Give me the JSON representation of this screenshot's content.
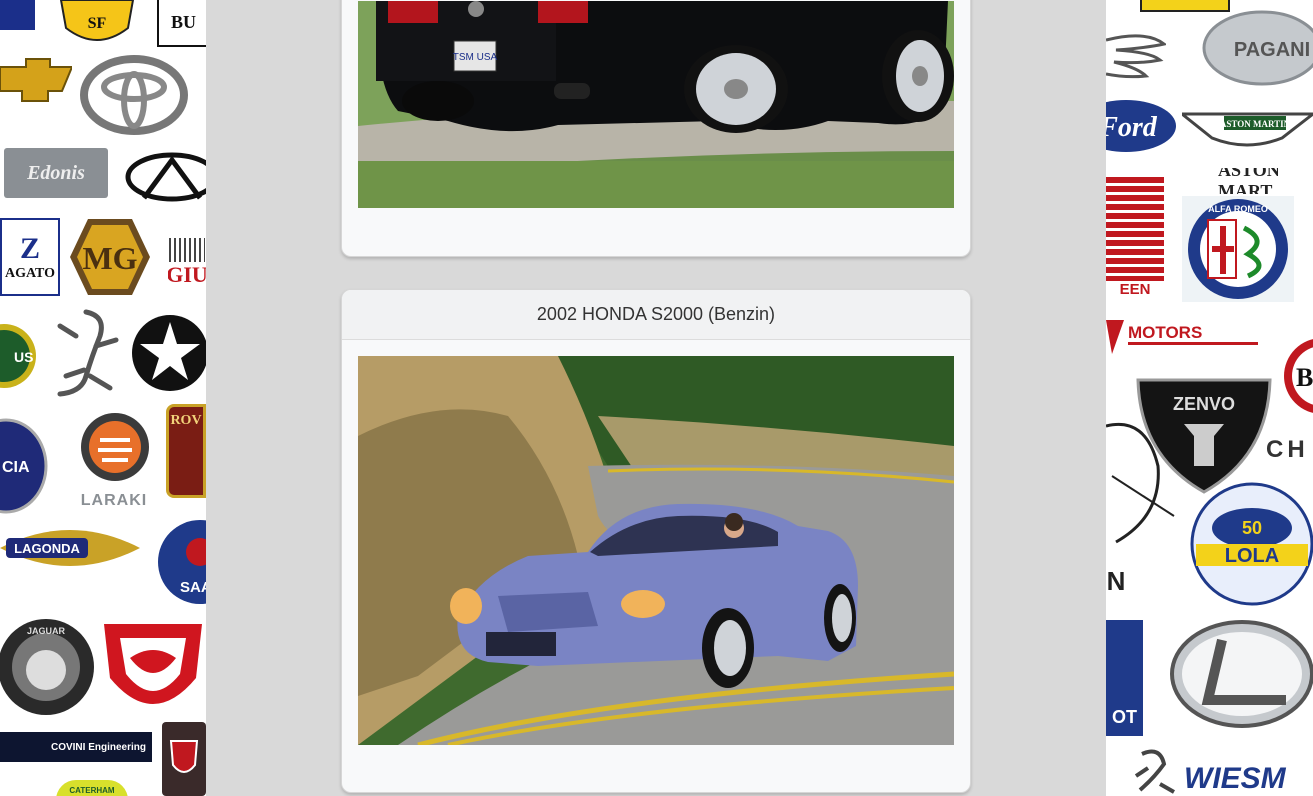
{
  "left_logos": [
    {
      "name": "logo-ferrari",
      "text": "SF"
    },
    {
      "name": "logo-bugatti",
      "text": "BU"
    },
    {
      "name": "logo-chevrolet",
      "text": ""
    },
    {
      "name": "logo-toyota",
      "text": ""
    },
    {
      "name": "logo-edonis",
      "text": "Edonis"
    },
    {
      "name": "logo-infiniti",
      "text": ""
    },
    {
      "name": "logo-zagato",
      "text": "AGATO"
    },
    {
      "name": "logo-mg",
      "text": "MG"
    },
    {
      "name": "logo-giugiaro",
      "text": "GIU"
    },
    {
      "name": "logo-lotus",
      "text": "US"
    },
    {
      "name": "logo-gecko",
      "text": ""
    },
    {
      "name": "logo-plymouth",
      "text": ""
    },
    {
      "name": "logo-rover",
      "text": "ROV"
    },
    {
      "name": "logo-lancia",
      "text": "CIA"
    },
    {
      "name": "logo-laraki",
      "text": "LARAKI"
    },
    {
      "name": "logo-lagonda",
      "text": "LAGONDA"
    },
    {
      "name": "logo-saab",
      "text": "SAA"
    },
    {
      "name": "logo-jaguar",
      "text": "JAGUAR"
    },
    {
      "name": "logo-viper",
      "text": ""
    },
    {
      "name": "logo-covini",
      "text": "COVINI Engineering"
    },
    {
      "name": "logo-caterham",
      "text": "CATERHAM"
    }
  ],
  "right_logos": [
    {
      "name": "logo-yellow-badge",
      "text": ""
    },
    {
      "name": "logo-wings",
      "text": ""
    },
    {
      "name": "logo-pagani",
      "text": "PAGANI"
    },
    {
      "name": "logo-ford",
      "text": "Ford"
    },
    {
      "name": "logo-aston-martin-wings",
      "text": "ASTON MARTIN"
    },
    {
      "name": "logo-aston-martin-text",
      "text": "ASTON MART"
    },
    {
      "name": "logo-saleen",
      "text": "EEN"
    },
    {
      "name": "logo-alfa-romeo",
      "text": "ALFA ROMEO"
    },
    {
      "name": "logo-motors",
      "text": "MOTORS"
    },
    {
      "name": "logo-zenvo",
      "text": "ZENVO"
    },
    {
      "name": "logo-maserati",
      "text": ""
    },
    {
      "name": "logo-che",
      "text": "CH"
    },
    {
      "name": "logo-lola",
      "text": "LOLA"
    },
    {
      "name": "logo-peugeot",
      "text": "OT"
    },
    {
      "name": "logo-lexus",
      "text": ""
    },
    {
      "name": "logo-wiesmann",
      "text": "WIESM"
    }
  ],
  "cards": [
    {
      "title": "",
      "photo_alt": "Black Ford Mustang rear view"
    },
    {
      "title": "2002 HONDA S2000 (Benzin)",
      "photo_alt": "Blue Honda S2000 on a curving road"
    }
  ]
}
